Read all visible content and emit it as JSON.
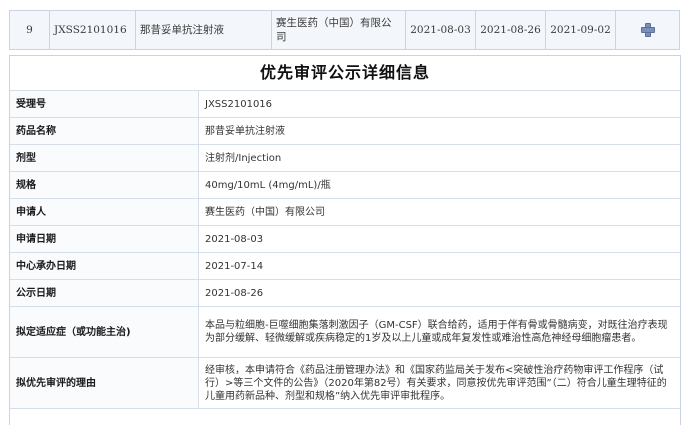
{
  "summary_row": {
    "index": "9",
    "acceptance_no": "JXSS2101016",
    "drug_name": "那昔妥单抗注射液",
    "applicant": "赛生医药（中国）有限公司",
    "date_1": "2021-08-03",
    "date_2": "2021-08-26",
    "date_3": "2021-09-02",
    "expand_icon": "plus-icon"
  },
  "detail": {
    "title": "优先审评公示详细信息",
    "rows": [
      {
        "label": "受理号",
        "value": "JXSS2101016"
      },
      {
        "label": "药品名称",
        "value": "那昔妥单抗注射液"
      },
      {
        "label": "剂型",
        "value": "注射剂/Injection"
      },
      {
        "label": "规格",
        "value": "40mg/10mL (4mg/mL)/瓶"
      },
      {
        "label": "申请人",
        "value": "赛生医药（中国）有限公司"
      },
      {
        "label": "申请日期",
        "value": "2021-08-03"
      },
      {
        "label": "中心承办日期",
        "value": "2021-07-14"
      },
      {
        "label": "公示日期",
        "value": "2021-08-26"
      },
      {
        "label": "拟定适应症（或功能主治)",
        "value": "本品与粒细胞-巨噬细胞集落刺激因子（GM-CSF）联合给药，适用于伴有骨或骨髓病变，对既往治疗表现为部分缓解、轻微缓解或疾病稳定的1岁及以上儿童或成年复发性或难治性高危神经母细胞瘤患者。"
      },
      {
        "label": "拟优先审评的理由",
        "value": "经审核，本申请符合《药品注册管理办法》和《国家药监局关于发布<突破性治疗药物审评工作程序（试行）>等三个文件的公告》（2020年第82号）有关要求，同意按优先审评范围”（二）符合儿童生理特征的儿童用药新品种、剂型和规格”纳入优先审评审批程序。"
      }
    ]
  }
}
